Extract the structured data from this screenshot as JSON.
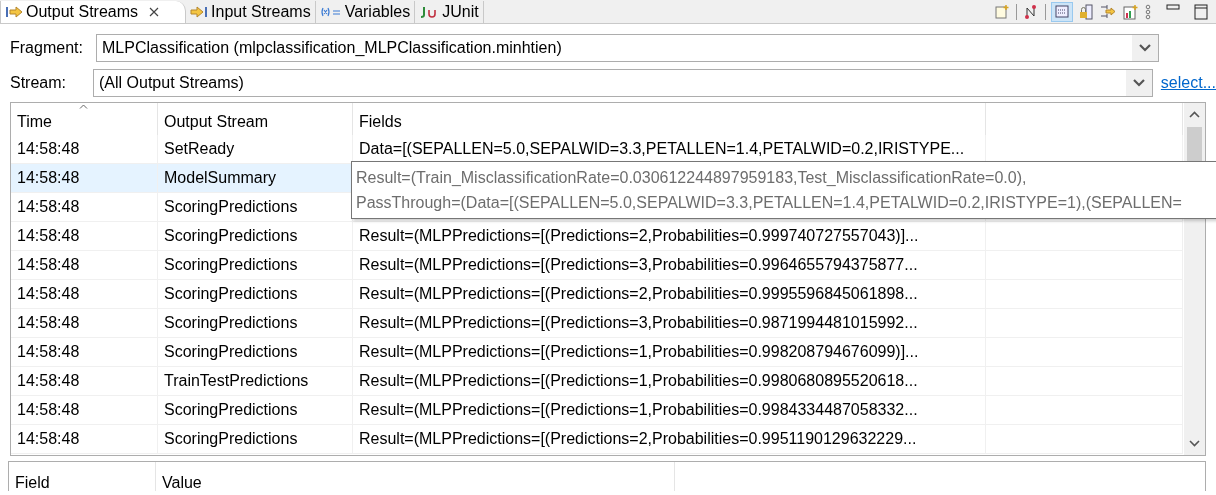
{
  "tabs": [
    {
      "label": "Output Streams",
      "selected": true
    },
    {
      "label": "Input Streams",
      "selected": false
    },
    {
      "label": "Variables",
      "selected": false
    },
    {
      "label": "JUnit",
      "selected": false
    }
  ],
  "fragment": {
    "label": "Fragment:",
    "value": "MLPClassification (mlpclassification_MLPClassification.minhtien)"
  },
  "stream": {
    "label": "Stream:",
    "value": "(All Output Streams)",
    "link": "select..."
  },
  "table": {
    "columns": [
      "Time",
      "Output Stream",
      "Fields"
    ],
    "rows": [
      {
        "time": "14:58:48",
        "stream": "SetReady",
        "fields": "Data=[(SEPALLEN=5.0,SEPALWID=3.3,PETALLEN=1.4,PETALWID=0.2,IRISTYPE...",
        "selected": false
      },
      {
        "time": "14:58:48",
        "stream": "ModelSummary",
        "selected": true
      },
      {
        "time": "14:58:48",
        "stream": "ScoringPredictions",
        "selected": false
      },
      {
        "time": "14:58:48",
        "stream": "ScoringPredictions",
        "fields": "Result=(MLPPredictions=[(Predictions=2,Probabilities=0.999740727557043)]...",
        "selected": false
      },
      {
        "time": "14:58:48",
        "stream": "ScoringPredictions",
        "fields": "Result=(MLPPredictions=[(Predictions=3,Probabilities=0.9964655794375877...",
        "selected": false
      },
      {
        "time": "14:58:48",
        "stream": "ScoringPredictions",
        "fields": "Result=(MLPPredictions=[(Predictions=2,Probabilities=0.9995596845061898...",
        "selected": false
      },
      {
        "time": "14:58:48",
        "stream": "ScoringPredictions",
        "fields": "Result=(MLPPredictions=[(Predictions=3,Probabilities=0.9871994481015992...",
        "selected": false
      },
      {
        "time": "14:58:48",
        "stream": "ScoringPredictions",
        "fields": "Result=(MLPPredictions=[(Predictions=1,Probabilities=0.998208794676099)]...",
        "selected": false
      },
      {
        "time": "14:58:48",
        "stream": "TrainTestPredictions",
        "fields": "Result=(MLPPredictions=[(Predictions=1,Probabilities=0.9980680895520618...",
        "selected": false
      },
      {
        "time": "14:58:48",
        "stream": "ScoringPredictions",
        "fields": "Result=(MLPPredictions=[(Predictions=1,Probabilities=0.9984334487058332...",
        "selected": false
      },
      {
        "time": "14:58:48",
        "stream": "ScoringPredictions",
        "fields": "Result=(MLPPredictions=[(Predictions=2,Probabilities=0.9951190129632229...",
        "selected": false
      }
    ]
  },
  "tooltip": {
    "lines": [
      "Result=(Train_MisclassificationRate=0.030612244897959183,Test_MisclassificationRate=0.0),",
      "PassThrough=(Data=[(SEPALLEN=5.0,SEPALWID=3.3,PETALLEN=1.4,PETALWID=0.2,IRISTYPE=1),(SEPALLEN="
    ]
  },
  "details": {
    "columns": [
      "Field",
      "Value"
    ]
  }
}
